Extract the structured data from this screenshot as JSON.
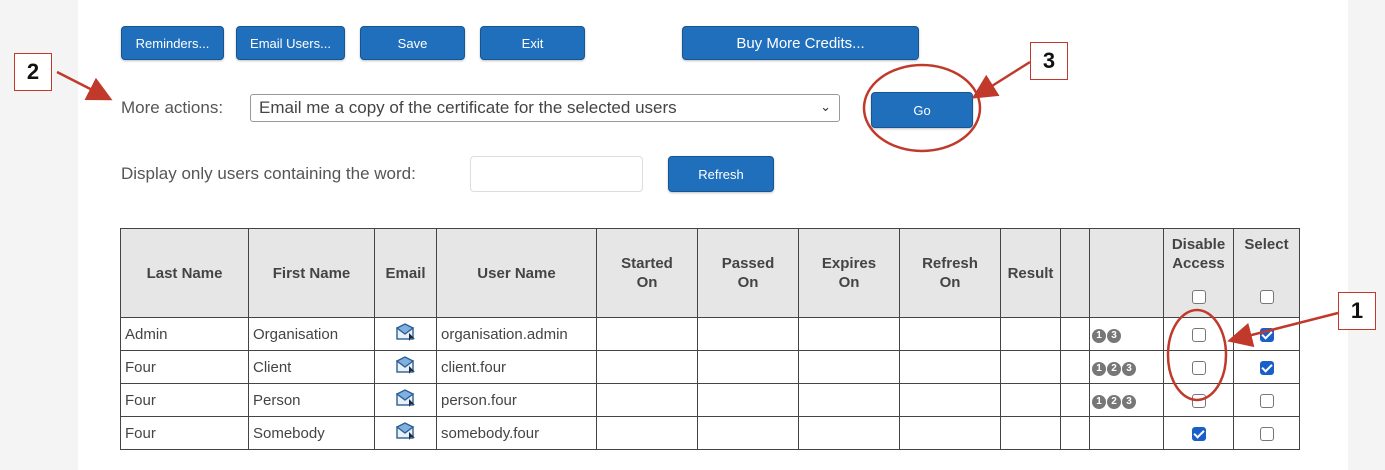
{
  "toolbar": {
    "reminders": "Reminders...",
    "email_users": "Email Users...",
    "save": "Save",
    "exit": "Exit",
    "buy_credits": "Buy More Credits..."
  },
  "more_actions": {
    "label": "More actions:",
    "selected": "Email me a copy of the certificate for the selected users",
    "go": "Go"
  },
  "filter": {
    "label": "Display only users containing the word:",
    "value": "",
    "refresh": "Refresh"
  },
  "table": {
    "headers": {
      "last_name": "Last Name",
      "first_name": "First Name",
      "email": "Email",
      "user_name": "User Name",
      "started_on": "Started On",
      "passed_on": "Passed On",
      "expires_on": "Expires On",
      "refresh_on": "Refresh On",
      "result": "Result",
      "disable_access": "Disable Access",
      "select": "Select"
    },
    "rows": [
      {
        "last": "Admin",
        "first": "Organisation",
        "user": "organisation.admin",
        "badges": "1 3",
        "disable": false,
        "select": true
      },
      {
        "last": "Four",
        "first": "Client",
        "user": "client.four",
        "badges": "1 2 3",
        "disable": false,
        "select": true
      },
      {
        "last": "Four",
        "first": "Person",
        "user": "person.four",
        "badges": "1 2 3",
        "disable": false,
        "select": false
      },
      {
        "last": "Four",
        "first": "Somebody",
        "user": "somebody.four",
        "badges": "",
        "disable": true,
        "select": false
      }
    ]
  },
  "annotations": {
    "callout_1": "1",
    "callout_2": "2",
    "callout_3": "3",
    "color": "#c0392b"
  }
}
